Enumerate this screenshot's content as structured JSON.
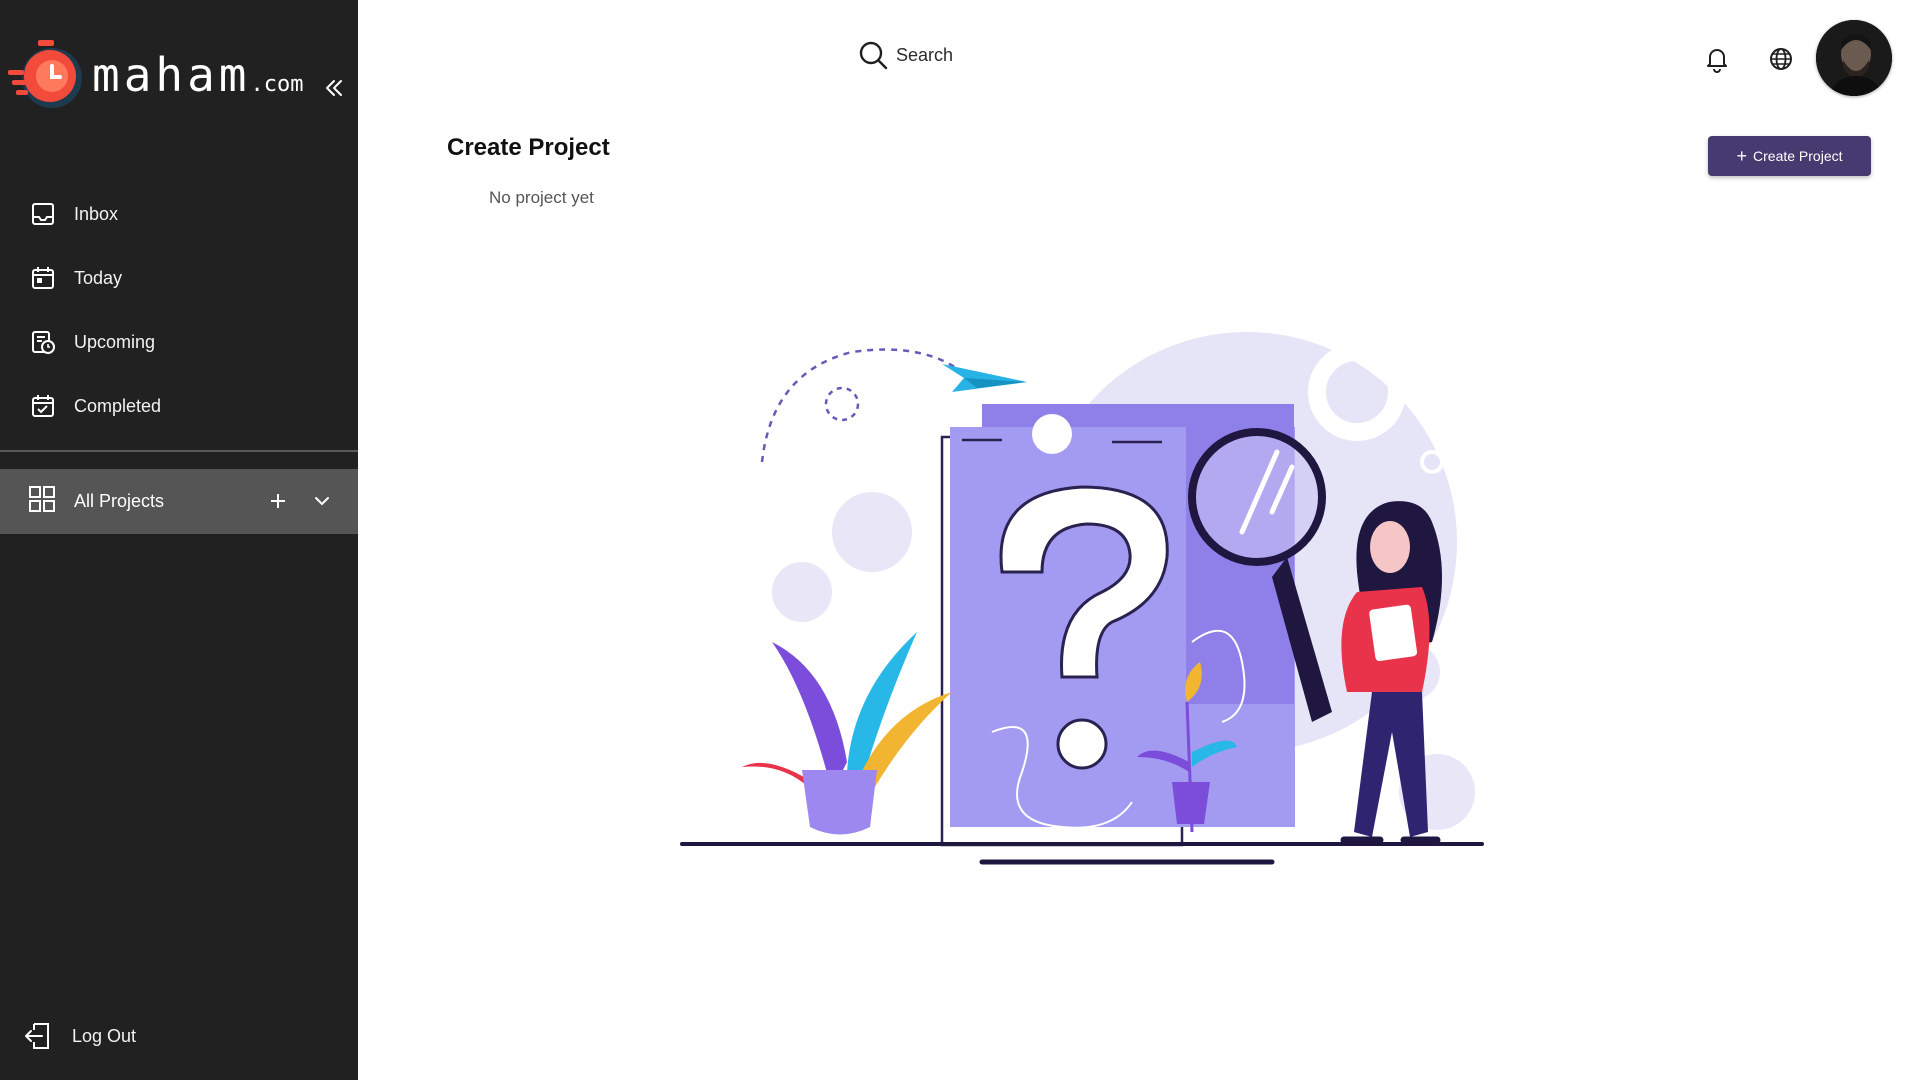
{
  "brand": {
    "name": "maham",
    "tld": ".com"
  },
  "sidebar": {
    "items": [
      {
        "label": "Inbox",
        "icon": "inbox-icon"
      },
      {
        "label": "Today",
        "icon": "calendar-today-icon"
      },
      {
        "label": "Upcoming",
        "icon": "calendar-clock-icon"
      },
      {
        "label": "Completed",
        "icon": "calendar-check-icon"
      }
    ],
    "projects": {
      "label": "All Projects",
      "icon": "grid-icon"
    },
    "logout_label": "Log Out"
  },
  "header": {
    "search_placeholder": "Search"
  },
  "main": {
    "title": "Create Project",
    "empty_text": "No project yet",
    "create_button_label": "Create Project"
  },
  "colors": {
    "sidebar_bg": "#212121",
    "active_row_bg": "#555555",
    "accent": "#473a70",
    "logo_red": "#f24b3b",
    "illustration_purple": "#a39af2"
  }
}
